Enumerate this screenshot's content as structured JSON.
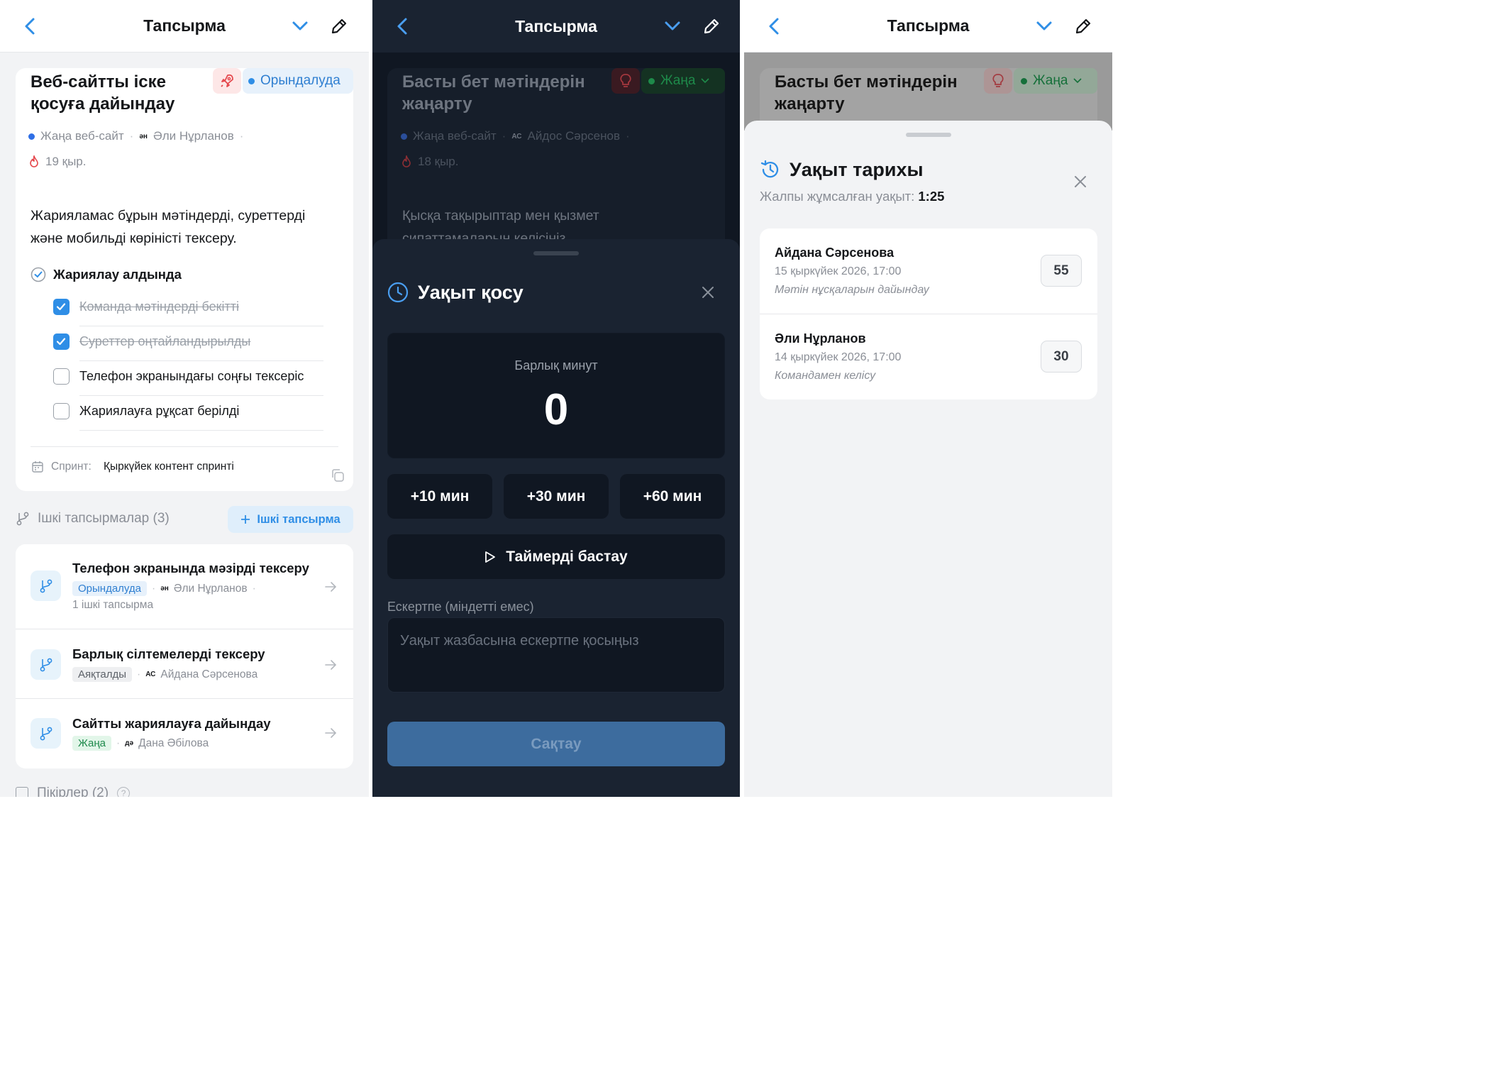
{
  "nav": {
    "title": "Тапсырма"
  },
  "panel1": {
    "task_title_line1": "Веб-сайтты іске",
    "task_title_line2": "қосуға дайындау",
    "status_label": "Орындалуда",
    "project": "Жаңа веб-сайт",
    "assignee_initials": "ӘН",
    "assignee": "Әли Нұрланов",
    "due": "19 қыр.",
    "description_line1": "Жарияламас бұрын мәтіндерді, суреттерді",
    "description_line2": "және мобильді көріністі тексеру.",
    "checklist_title": "Жариялау алдында",
    "checklist": [
      {
        "label": "Команда мәтіндерді бекітті",
        "done": true
      },
      {
        "label": "Суреттер оңтайландырылды",
        "done": true
      },
      {
        "label": "Телефон экранындағы соңғы тексеріс",
        "done": false
      },
      {
        "label": "Жариялауға рұқсат берілді",
        "done": false
      }
    ],
    "sprint_label": "Спринт:",
    "sprint_value": "Қыркүйек контент спринті",
    "subtasks_header": "Ішкі тапсырмалар (3)",
    "add_subtask": "Ішкі тапсырма",
    "subtasks": [
      {
        "title": "Телефон экранында мәзірді тексеру",
        "status": "Орындалуда",
        "initials": "ӘН",
        "assignee": "Әли Нұрланов",
        "extra": "1 ішкі тапсырма"
      },
      {
        "title": "Барлық сілтемелерді тексеру",
        "status": "Аяқталды",
        "initials": "АС",
        "assignee": "Айдана Сәрсенова"
      },
      {
        "title": "Сайтты жариялауға дайындау",
        "status": "Жаңа",
        "initials": "ДӘ",
        "assignee": "Дана Әбілова"
      }
    ],
    "comments_header": "Пікірлер (2)"
  },
  "panel2": {
    "task_title_line1": "Басты бет мәтіндерін",
    "task_title_line2": "жаңарту",
    "status_label": "Жаңа",
    "project": "Жаңа веб-сайт",
    "assignee_initials": "АС",
    "assignee": "Айдос Сәрсенов",
    "due": "18 қыр.",
    "description_line1": "Қысқа тақырыптар мен қызмет",
    "description_line2": "сипаттамаларын келісіңіз",
    "sheet_title": "Уақыт қосу",
    "total_label": "Барлық минут",
    "total_value": "0",
    "quick_buttons": [
      "+10 мин",
      "+30 мин",
      "+60 мин"
    ],
    "timer_button": "Таймерді бастау",
    "note_label": "Ескертпе (міндетті емес)",
    "note_placeholder": "Уақыт жазбасына ескертпе қосыңыз",
    "save_button": "Сақтау"
  },
  "panel3": {
    "task_title_line1": "Басты бет мәтіндерін",
    "task_title_line2": "жаңарту",
    "status_label": "Жаңа",
    "sheet_title": "Уақыт тарихы",
    "total_label": "Жалпы жұмсалған уақыт:",
    "total_value": "1:25",
    "entries": [
      {
        "name": "Айдана Сәрсенова",
        "date": "15 қыркүйек 2026, 17:00",
        "note": "Мәтін нұсқаларын дайындау",
        "minutes": "55"
      },
      {
        "name": "Әли Нұрланов",
        "date": "14 қыркүйек 2026, 17:00",
        "note": "Командамен келісу",
        "minutes": "30"
      }
    ]
  },
  "colors": {
    "accent": "#2f8ee6",
    "success": "#22a35a",
    "danger": "#e5484d",
    "dark_bg": "#101722",
    "dark_sheet": "#1a2331",
    "save_button": "#3d6c9e"
  }
}
